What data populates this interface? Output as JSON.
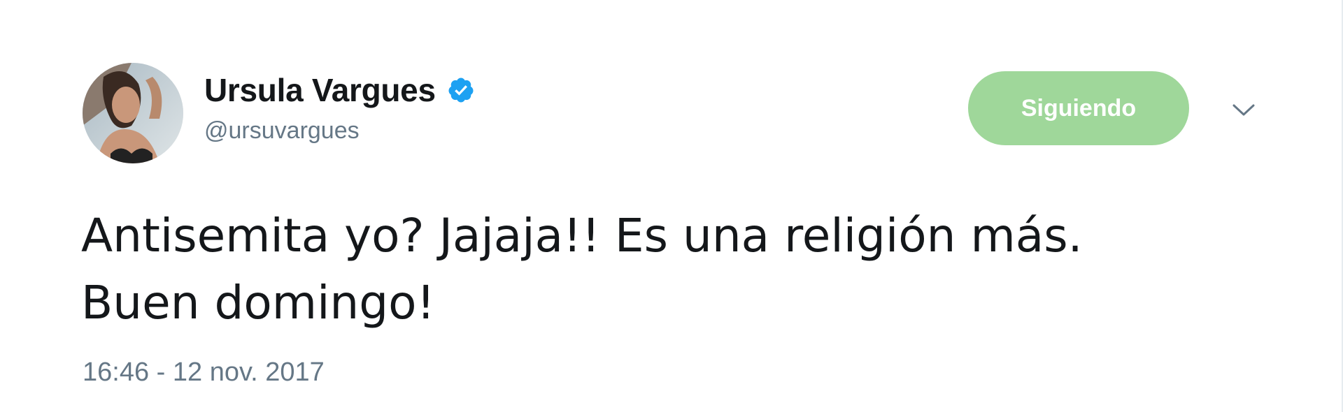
{
  "tweet": {
    "author": {
      "display_name": "Ursula Vargues",
      "handle": "@ursuvargues",
      "verified": true,
      "verified_icon": "verified-badge-icon",
      "avatar": "user-avatar"
    },
    "follow_button_label": "Siguiendo",
    "menu_icon": "chevron-down-icon",
    "text_lines": [
      "Antisemita yo? Jajaja!! Es una religión más.",
      "Buen domingo!"
    ],
    "timestamp": "16:46 - 12 nov. 2017"
  },
  "colors": {
    "following_button_bg": "#9fd79a",
    "verified_blue": "#1da1f2",
    "secondary_text": "#657786",
    "primary_text": "#14171a"
  }
}
